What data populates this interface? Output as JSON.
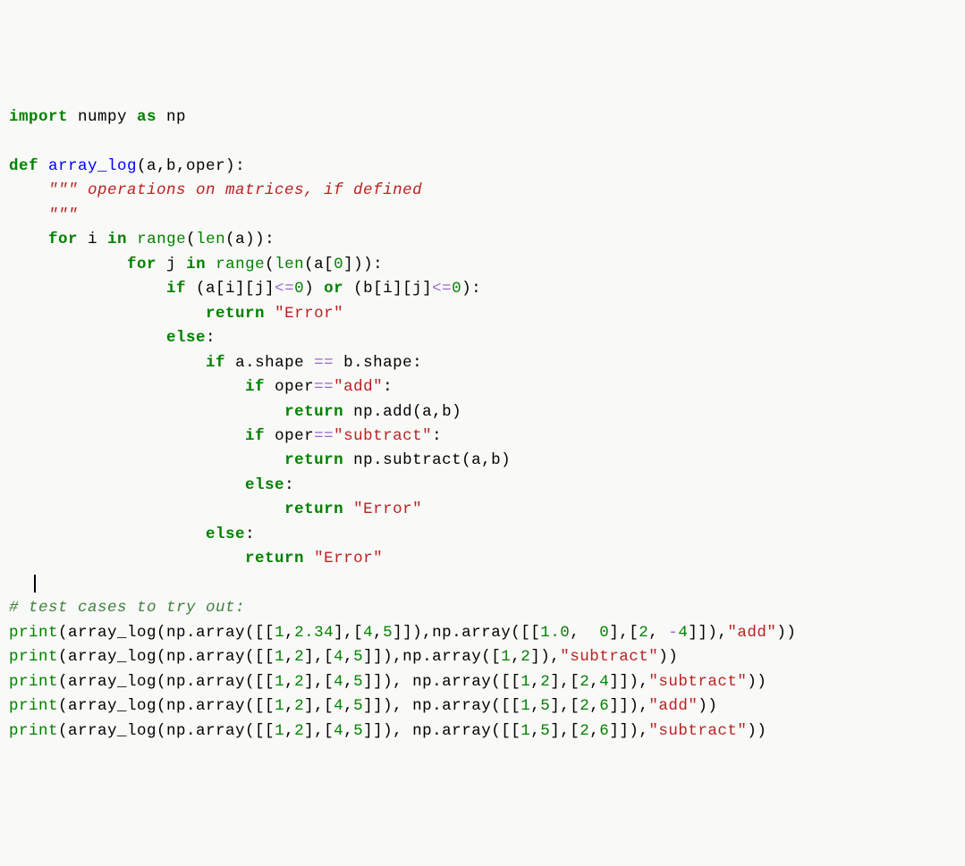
{
  "code": {
    "line1": {
      "import": "import",
      "numpy": " numpy ",
      "as": "as",
      "np": " np"
    },
    "line3": {
      "def": "def",
      "funcname": " array_log",
      "params": "(a,b,oper):"
    },
    "line4": {
      "docstring": "    \"\"\" operations on matrices, if defined"
    },
    "line5": {
      "docstring": "    \"\"\""
    },
    "line6": {
      "indent": "    ",
      "for": "for",
      "var": " i ",
      "in": "in",
      "sp": " ",
      "range": "range",
      "p1": "(",
      "len": "len",
      "p2": "(a)):"
    },
    "line7": {
      "indent": "            ",
      "for": "for",
      "var": " j ",
      "in": "in",
      "sp": " ",
      "range": "range",
      "p1": "(",
      "len": "len",
      "p2": "(a[",
      "zero": "0",
      "p3": "])):"
    },
    "line8": {
      "indent": "                ",
      "if": "if",
      "sp": " (a[i][j]",
      "op1": "<=",
      "zero1": "0",
      "p1": ") ",
      "or": "or",
      "p2": " (b[i][j]",
      "op2": "<=",
      "zero2": "0",
      "p3": "):"
    },
    "line9": {
      "indent": "                    ",
      "return": "return",
      "sp": " ",
      "str": "\"Error\""
    },
    "line10": {
      "indent": "                ",
      "else": "else",
      "colon": ":"
    },
    "line11": {
      "indent": "                    ",
      "if": "if",
      "sp1": " a.shape ",
      "eq": "==",
      "sp2": " b.shape:"
    },
    "line12": {
      "indent": "                        ",
      "if": "if",
      "sp": " oper",
      "eq": "==",
      "str": "\"add\"",
      "colon": ":"
    },
    "line13": {
      "indent": "                            ",
      "return": "return",
      "sp": " np.add(a,b)"
    },
    "line14": {
      "indent": "                        ",
      "if": "if",
      "sp": " oper",
      "eq": "==",
      "str": "\"subtract\"",
      "colon": ":"
    },
    "line15": {
      "indent": "                            ",
      "return": "return",
      "sp": " np.subtract(a,b)"
    },
    "line16": {
      "indent": "                        ",
      "else": "else",
      "colon": ":"
    },
    "line17": {
      "indent": "                            ",
      "return": "return",
      "sp": " ",
      "str": "\"Error\""
    },
    "line18": {
      "indent": "                    ",
      "else": "else",
      "colon": ":"
    },
    "line19": {
      "indent": "                        ",
      "return": "return",
      "sp": " ",
      "str": "\"Error\""
    },
    "line21": {
      "comment": "# test cases to try out:"
    },
    "line22": {
      "print": "print",
      "p1": "(array_log(np.array([[",
      "n1": "1",
      "c1": ",",
      "n2": "2.34",
      "p2": "],[",
      "n3": "4",
      "c2": ",",
      "n4": "5",
      "p3": "]]),np.array([[",
      "n5": "1.0",
      "c3": ",  ",
      "n6": "0",
      "p4": "],[",
      "n7": "2",
      "c4": ", ",
      "op": "-",
      "n8": "4",
      "p5": "]]),",
      "str": "\"add\"",
      "p6": "))"
    },
    "line23": {
      "print": "print",
      "p1": "(array_log(np.array([[",
      "n1": "1",
      "c1": ",",
      "n2": "2",
      "p2": "],[",
      "n3": "4",
      "c2": ",",
      "n4": "5",
      "p3": "]]),np.array([",
      "n5": "1",
      "c3": ",",
      "n6": "2",
      "p4": "]),",
      "str": "\"subtract\"",
      "p5": "))"
    },
    "line24": {
      "print": "print",
      "p1": "(array_log(np.array([[",
      "n1": "1",
      "c1": ",",
      "n2": "2",
      "p2": "],[",
      "n3": "4",
      "c2": ",",
      "n4": "5",
      "p3": "]]), np.array([[",
      "n5": "1",
      "c3": ",",
      "n6": "2",
      "p4": "],[",
      "n7": "2",
      "c4": ",",
      "n8": "4",
      "p5": "]]),",
      "str": "\"subtract\"",
      "p6": "))"
    },
    "line25": {
      "print": "print",
      "p1": "(array_log(np.array([[",
      "n1": "1",
      "c1": ",",
      "n2": "2",
      "p2": "],[",
      "n3": "4",
      "c2": ",",
      "n4": "5",
      "p3": "]]), np.array([[",
      "n5": "1",
      "c3": ",",
      "n6": "5",
      "p4": "],[",
      "n7": "2",
      "c4": ",",
      "n8": "6",
      "p5": "]]),",
      "str": "\"add\"",
      "p6": "))"
    },
    "line26": {
      "print": "print",
      "p1": "(array_log(np.array([[",
      "n1": "1",
      "c1": ",",
      "n2": "2",
      "p2": "],[",
      "n3": "4",
      "c2": ",",
      "n4": "5",
      "p3": "]]), np.array([[",
      "n5": "1",
      "c3": ",",
      "n6": "5",
      "p4": "],[",
      "n7": "2",
      "c4": ",",
      "n8": "6",
      "p5": "]]),",
      "str": "\"subtract\"",
      "p6": "))"
    }
  }
}
